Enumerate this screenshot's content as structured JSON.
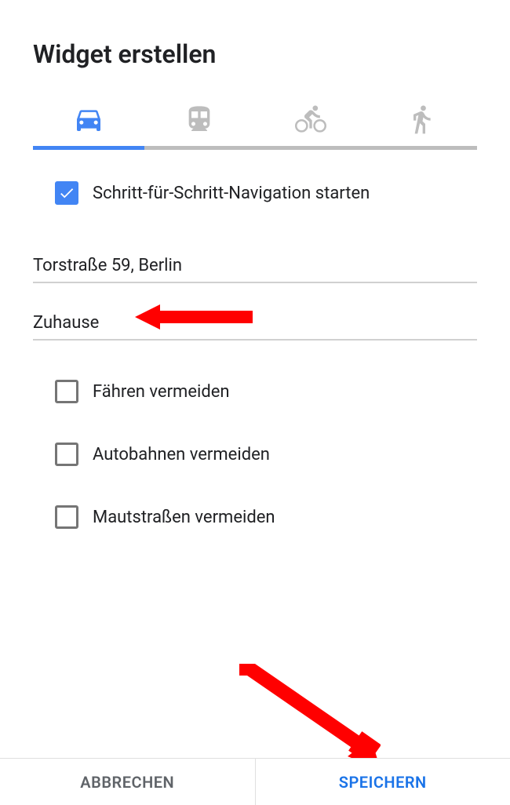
{
  "title": "Widget erstellen",
  "tabs": {
    "active_index": 0,
    "items": [
      "car",
      "transit",
      "bike",
      "walk"
    ]
  },
  "nav_checkbox": {
    "label": "Schritt-für-Schritt-Navigation starten",
    "checked": true
  },
  "origin": "Torstraße 59, Berlin",
  "destination": "Zuhause",
  "options": [
    {
      "label": "Fähren vermeiden",
      "checked": false
    },
    {
      "label": "Autobahnen vermeiden",
      "checked": false
    },
    {
      "label": "Mautstraßen vermeiden",
      "checked": false
    }
  ],
  "footer": {
    "cancel": "ABBRECHEN",
    "save": "SPEICHERN"
  },
  "colors": {
    "accent": "#4285f4",
    "annotation": "#ff0000"
  }
}
